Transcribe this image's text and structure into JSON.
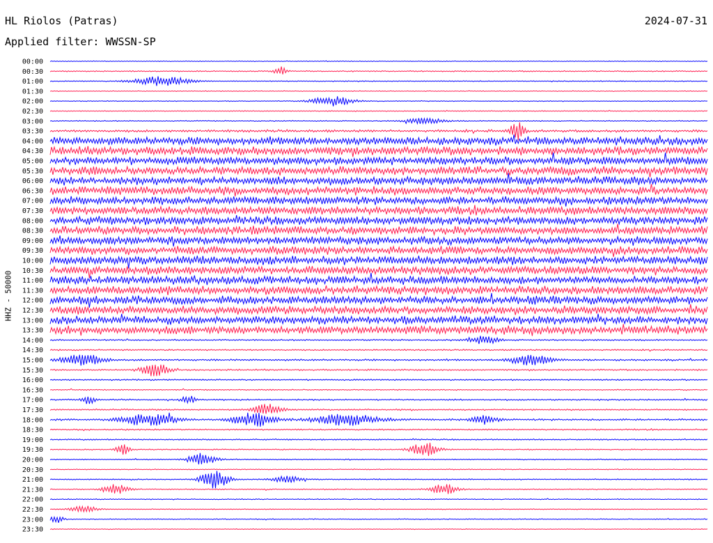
{
  "header": {
    "title": "HL Riolos (Patras)",
    "date": "2024-07-31",
    "filter": "Applied filter: WWSSN-SP",
    "ylabel": "HHZ - 50000"
  },
  "chart_data": {
    "type": "line",
    "title": "HL Riolos (Patras)",
    "xlabel": "",
    "ylabel": "HHZ - 50000",
    "date": "2024-07-31",
    "colors": {
      "odd_row": "#0000ff",
      "even_row": "#ff1a4d"
    },
    "time_labels": [
      "00:00",
      "00:30",
      "01:00",
      "01:30",
      "02:00",
      "02:30",
      "03:00",
      "03:30",
      "04:00",
      "04:30",
      "05:00",
      "05:30",
      "06:00",
      "06:30",
      "07:00",
      "07:30",
      "08:00",
      "08:30",
      "09:00",
      "09:30",
      "10:00",
      "10:30",
      "11:00",
      "11:30",
      "12:00",
      "12:30",
      "13:00",
      "13:30",
      "14:00",
      "14:30",
      "15:00",
      "15:30",
      "16:00",
      "16:30",
      "17:00",
      "17:30",
      "18:00",
      "18:30",
      "19:00",
      "19:30",
      "20:00",
      "20:30",
      "21:00",
      "21:30",
      "22:00",
      "22:30",
      "23:00",
      "23:30"
    ],
    "noise_level": [
      0.4,
      0.6,
      0.5,
      0.4,
      0.4,
      0.5,
      0.5,
      1.4,
      4.5,
      4.5,
      4.5,
      4.5,
      4.5,
      4.5,
      4.5,
      4.5,
      4.5,
      4.5,
      4.5,
      4.5,
      4.5,
      4.5,
      4.5,
      4.5,
      4.5,
      4.5,
      4.5,
      4.5,
      0.8,
      0.8,
      1.0,
      0.8,
      0.8,
      0.6,
      0.8,
      0.8,
      1.0,
      0.8,
      0.7,
      0.6,
      0.6,
      0.5,
      0.6,
      0.6,
      0.5,
      0.5,
      0.5,
      0.4
    ],
    "events": [
      {
        "row": 1,
        "pos": 0.35,
        "amp": 6,
        "width": 0.01
      },
      {
        "row": 2,
        "pos": 0.17,
        "amp": 7,
        "width": 0.04
      },
      {
        "row": 4,
        "pos": 0.43,
        "amp": 7,
        "width": 0.03
      },
      {
        "row": 6,
        "pos": 0.57,
        "amp": 4,
        "width": 0.03
      },
      {
        "row": 7,
        "pos": 0.71,
        "amp": 14,
        "width": 0.01
      },
      {
        "row": 28,
        "pos": 0.66,
        "amp": 6,
        "width": 0.02
      },
      {
        "row": 30,
        "pos": 0.05,
        "amp": 8,
        "width": 0.03
      },
      {
        "row": 30,
        "pos": 0.73,
        "amp": 8,
        "width": 0.03
      },
      {
        "row": 31,
        "pos": 0.16,
        "amp": 10,
        "width": 0.02
      },
      {
        "row": 34,
        "pos": 0.06,
        "amp": 5,
        "width": 0.01
      },
      {
        "row": 34,
        "pos": 0.21,
        "amp": 6,
        "width": 0.01
      },
      {
        "row": 35,
        "pos": 0.33,
        "amp": 8,
        "width": 0.02
      },
      {
        "row": 36,
        "pos": 0.15,
        "amp": 9,
        "width": 0.04
      },
      {
        "row": 36,
        "pos": 0.31,
        "amp": 10,
        "width": 0.03
      },
      {
        "row": 36,
        "pos": 0.45,
        "amp": 8,
        "width": 0.05
      },
      {
        "row": 36,
        "pos": 0.66,
        "amp": 6,
        "width": 0.02
      },
      {
        "row": 39,
        "pos": 0.11,
        "amp": 8,
        "width": 0.01
      },
      {
        "row": 39,
        "pos": 0.57,
        "amp": 10,
        "width": 0.02
      },
      {
        "row": 40,
        "pos": 0.23,
        "amp": 9,
        "width": 0.02
      },
      {
        "row": 42,
        "pos": 0.25,
        "amp": 14,
        "width": 0.02
      },
      {
        "row": 42,
        "pos": 0.36,
        "amp": 5,
        "width": 0.02
      },
      {
        "row": 43,
        "pos": 0.1,
        "amp": 7,
        "width": 0.02
      },
      {
        "row": 43,
        "pos": 0.6,
        "amp": 8,
        "width": 0.02
      },
      {
        "row": 45,
        "pos": 0.05,
        "amp": 5,
        "width": 0.02
      },
      {
        "row": 46,
        "pos": 0.01,
        "amp": 5,
        "width": 0.01
      }
    ]
  }
}
